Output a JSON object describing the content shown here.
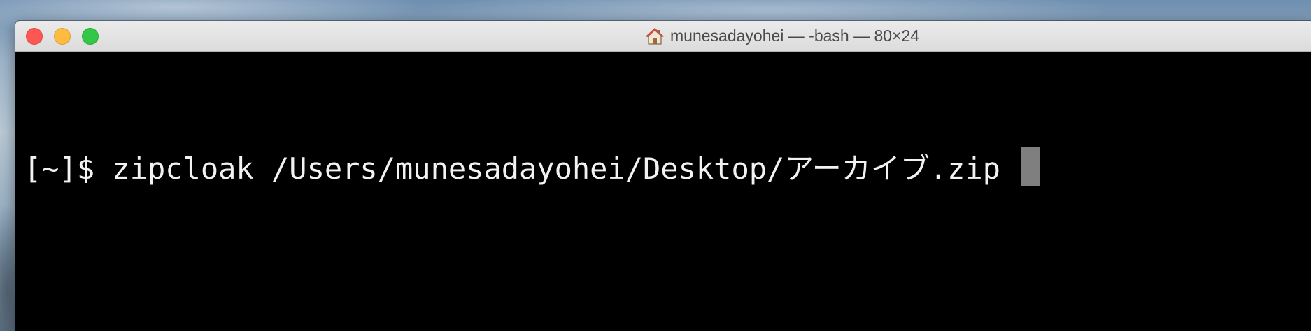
{
  "window": {
    "title": "munesadayohei — -bash — 80×24",
    "title_icon": "home-icon"
  },
  "terminal": {
    "prompt_prefix": "[",
    "command_line": "[~]$ zipcloak /Users/munesadayohei/Desktop/アーカイブ.zip ",
    "cursor": "block"
  },
  "colors": {
    "close": "#fc5753",
    "minimize": "#fdbc40",
    "zoom": "#33c748",
    "terminal_bg": "#000000",
    "terminal_text": "#f2f2f2",
    "cursor": "#7f7f7f"
  }
}
